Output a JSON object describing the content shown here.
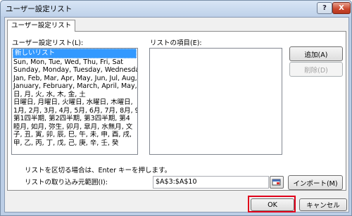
{
  "window": {
    "title": "ユーザー設定リスト",
    "help_glyph": "?",
    "close_glyph": "X"
  },
  "tab": {
    "label": "ユーザー設定リスト"
  },
  "custom_lists": {
    "label": "ユーザー設定リスト(L):",
    "items": [
      "新しいリスト",
      "Sun, Mon, Tue, Wed, Thu, Fri, Sat",
      "Sunday, Monday, Tuesday, Wednesday",
      "Jan, Feb, Mar, Apr, May, Jun, Jul, Aug,",
      "January, February, March, April, May, J",
      "日, 月, 火, 水, 木, 金, 土",
      "日曜日, 月曜日, 火曜日, 水曜日, 木曜日,",
      "1月, 2月, 3月, 4月, 5月, 6月, 7月, 8月, 9",
      "第1四半期, 第2四半期, 第3四半期, 第4",
      "睦月, 如月, 弥生, 卯月, 皐月, 水無月, 文",
      "子, 丑, 寅, 卯, 辰, 巳, 午, 未, 申, 酉, 戌,",
      "甲, 乙, 丙, 丁, 戊, 己, 庚, 辛, 壬, 癸"
    ]
  },
  "list_entries": {
    "label": "リストの項目(E):"
  },
  "buttons": {
    "add": "追加(A)",
    "delete": "削除(D)",
    "import": "インポート(M)",
    "ok": "OK",
    "cancel": "キャンセル"
  },
  "separator_note": "リストを区切る場合は、Enter キーを押します。",
  "import_range": {
    "label": "リストの取り込み元範囲(I):",
    "value": "$A$3:$A$10"
  }
}
